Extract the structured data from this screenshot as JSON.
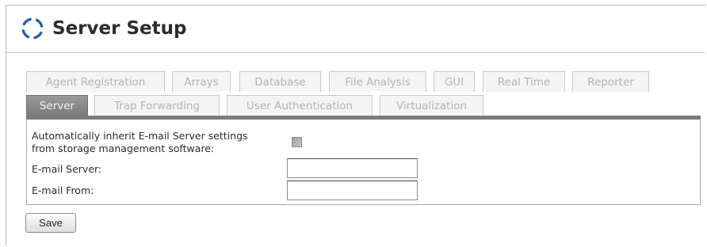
{
  "header": {
    "title": "Server Setup",
    "logo_icon": "circular-dashed-ring-icon",
    "accent_color": "#1f5fa8"
  },
  "tabs": {
    "row1": [
      {
        "label": "Agent Registration",
        "active": false
      },
      {
        "label": "Arrays",
        "active": false
      },
      {
        "label": "Database",
        "active": false
      },
      {
        "label": "File Analysis",
        "active": false
      },
      {
        "label": "GUI",
        "active": false
      },
      {
        "label": "Real Time",
        "active": false
      },
      {
        "label": "Reporter",
        "active": false
      }
    ],
    "row2": [
      {
        "label": "Server",
        "active": true
      },
      {
        "label": "Trap Forwarding",
        "active": false
      },
      {
        "label": "User Authentication",
        "active": false
      },
      {
        "label": "Virtualization",
        "active": false
      }
    ]
  },
  "form": {
    "inherit_label_line1": "Automatically inherit E-mail Server settings",
    "inherit_label_line2": "from storage management software:",
    "inherit_checked": false,
    "email_server_label": "E-mail Server:",
    "email_server_value": "",
    "email_from_label": "E-mail From:",
    "email_from_value": ""
  },
  "actions": {
    "save_label": "Save"
  }
}
